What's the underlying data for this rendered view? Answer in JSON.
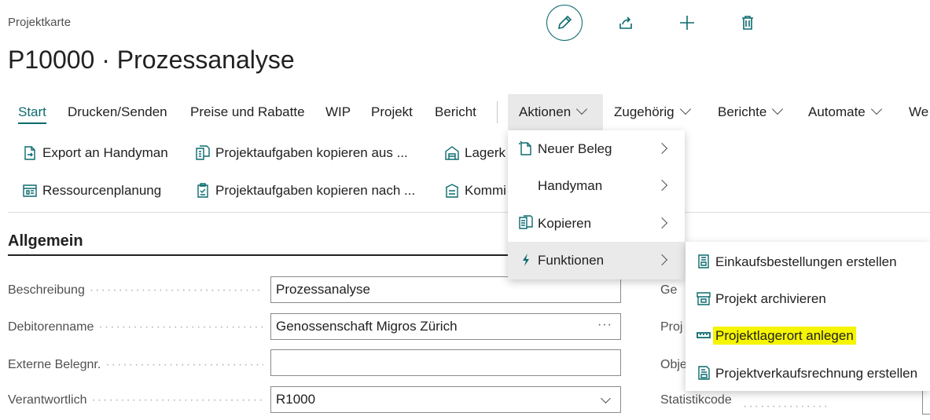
{
  "page": {
    "caption": "Projektkarte",
    "title": "P10000 · Prozessanalyse"
  },
  "header_actions": {
    "edit_icon": "pencil-icon",
    "share_icon": "share-icon",
    "add_icon": "plus-icon",
    "delete_icon": "trash-icon"
  },
  "tabs": {
    "start": "Start",
    "drucken": "Drucken/Senden",
    "preise": "Preise und Rabatte",
    "wip": "WIP",
    "projekt": "Projekt",
    "bericht": "Bericht",
    "aktionen": "Aktionen",
    "zugehoerig": "Zugehörig",
    "berichte": "Berichte",
    "automate": "Automate",
    "weitere": "We"
  },
  "actions": {
    "export_handyman": "Export an Handyman",
    "ressourcenplanung": "Ressourcenplanung",
    "aufgaben_kopieren_aus": "Projektaufgaben kopieren aus ...",
    "aufgaben_kopieren_nach": "Projektaufgaben kopieren nach ...",
    "lager": "Lagerk",
    "kommi": "Kommi"
  },
  "section": {
    "title": "Allgemein"
  },
  "fields": {
    "beschreibung": {
      "label": "Beschreibung",
      "value": "Prozessanalyse"
    },
    "debitorenname": {
      "label": "Debitorenname",
      "value": "Genossenschaft Migros Zürich",
      "more": "···"
    },
    "externe_belegnr": {
      "label": "Externe Belegnr.",
      "value": ""
    },
    "verantwortlich": {
      "label": "Verantwortlich",
      "value": "R1000"
    }
  },
  "right_fields": {
    "ge": "Ge",
    "proj": "Proj",
    "obj": "Obje",
    "statistikcode": "Statistikcode"
  },
  "menu_aktionen": {
    "items": [
      {
        "label": "Neuer Beleg",
        "icon": "new-document-icon"
      },
      {
        "label": "Handyman",
        "icon": ""
      },
      {
        "label": "Kopieren",
        "icon": "copy-icon"
      },
      {
        "label": "Funktionen",
        "icon": "lightning-icon"
      }
    ]
  },
  "menu_funktionen": {
    "items": [
      {
        "label": "Einkaufsbestellungen erstellen",
        "icon": "purchase-order-icon"
      },
      {
        "label": "Projekt archivieren",
        "icon": "archive-icon"
      },
      {
        "label": "Projektlagerort anlegen",
        "icon": "location-icon"
      },
      {
        "label": "Projektverkaufsrechnung erstellen",
        "icon": "invoice-icon"
      }
    ]
  },
  "colors": {
    "accent": "#0b6a6e",
    "highlight": "#f5f500",
    "menu_hover": "#eaeaea"
  }
}
